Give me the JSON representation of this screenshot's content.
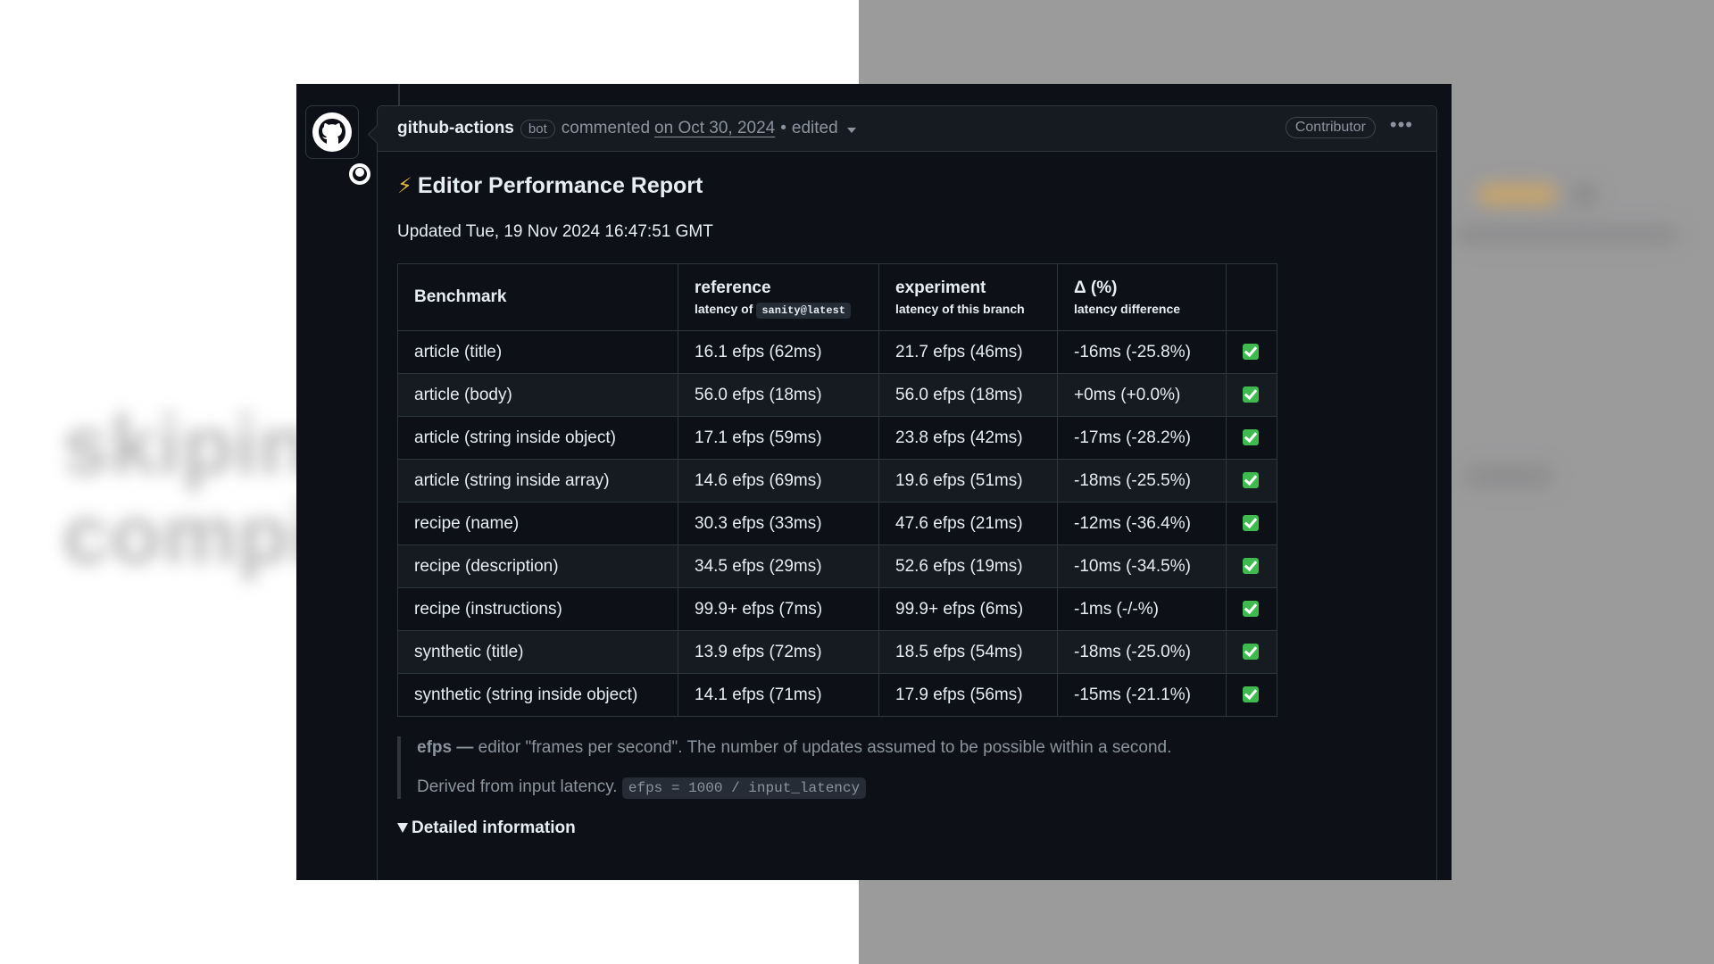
{
  "background": {
    "text_line_1": "skiping",
    "text_line_2": "compil"
  },
  "comment": {
    "author": "github-actions",
    "author_badge": "bot",
    "action": "commented",
    "date": "on Oct 30, 2024",
    "edited_label": "edited",
    "role_badge": "Contributor",
    "more_icon": "kebab-horizontal-icon"
  },
  "report": {
    "title_icon": "⚡",
    "title": "Editor Performance Report",
    "updated": "Updated Tue, 19 Nov 2024 16:47:51 GMT"
  },
  "table": {
    "headers": {
      "benchmark": "Benchmark",
      "reference": "reference",
      "reference_sub": "latency of",
      "reference_code": "sanity@latest",
      "experiment": "experiment",
      "experiment_sub": "latency of this branch",
      "delta": "Δ (%)",
      "delta_sub": "latency difference"
    },
    "rows": [
      {
        "benchmark": "article (title)",
        "reference": "16.1 efps (62ms)",
        "experiment": "21.7 efps (46ms)",
        "delta": "-16ms (-25.8%)",
        "status": "passed"
      },
      {
        "benchmark": "article (body)",
        "reference": "56.0 efps (18ms)",
        "experiment": "56.0 efps (18ms)",
        "delta": "+0ms (+0.0%)",
        "status": "passed"
      },
      {
        "benchmark": "article (string inside object)",
        "reference": "17.1 efps (59ms)",
        "experiment": "23.8 efps (42ms)",
        "delta": "-17ms (-28.2%)",
        "status": "passed"
      },
      {
        "benchmark": "article (string inside array)",
        "reference": "14.6 efps (69ms)",
        "experiment": "19.6 efps (51ms)",
        "delta": "-18ms (-25.5%)",
        "status": "passed"
      },
      {
        "benchmark": "recipe (name)",
        "reference": "30.3 efps (33ms)",
        "experiment": "47.6 efps (21ms)",
        "delta": "-12ms (-36.4%)",
        "status": "passed"
      },
      {
        "benchmark": "recipe (description)",
        "reference": "34.5 efps (29ms)",
        "experiment": "52.6 efps (19ms)",
        "delta": "-10ms (-34.5%)",
        "status": "passed"
      },
      {
        "benchmark": "recipe (instructions)",
        "reference": "99.9+ efps (7ms)",
        "experiment": "99.9+ efps (6ms)",
        "delta": "-1ms (-/-%)",
        "status": "passed"
      },
      {
        "benchmark": "synthetic (title)",
        "reference": "13.9 efps (72ms)",
        "experiment": "18.5 efps (54ms)",
        "delta": "-18ms (-25.0%)",
        "status": "passed"
      },
      {
        "benchmark": "synthetic (string inside object)",
        "reference": "14.1 efps (71ms)",
        "experiment": "17.9 efps (56ms)",
        "delta": "-15ms (-21.1%)",
        "status": "passed"
      }
    ]
  },
  "note": {
    "term": "efps",
    "dash": " — ",
    "definition": "editor \"frames per second\". The number of updates assumed to be possible within a second.",
    "derived": "Derived from input latency.",
    "formula": "efps = 1000 / input_latency"
  },
  "details": {
    "label": "Detailed information"
  },
  "colors": {
    "background": "#0d1117",
    "border": "#30363d",
    "text": "#e6edf3",
    "muted": "#8b949e",
    "check": "#3fb950",
    "zap": "#e3b341"
  }
}
